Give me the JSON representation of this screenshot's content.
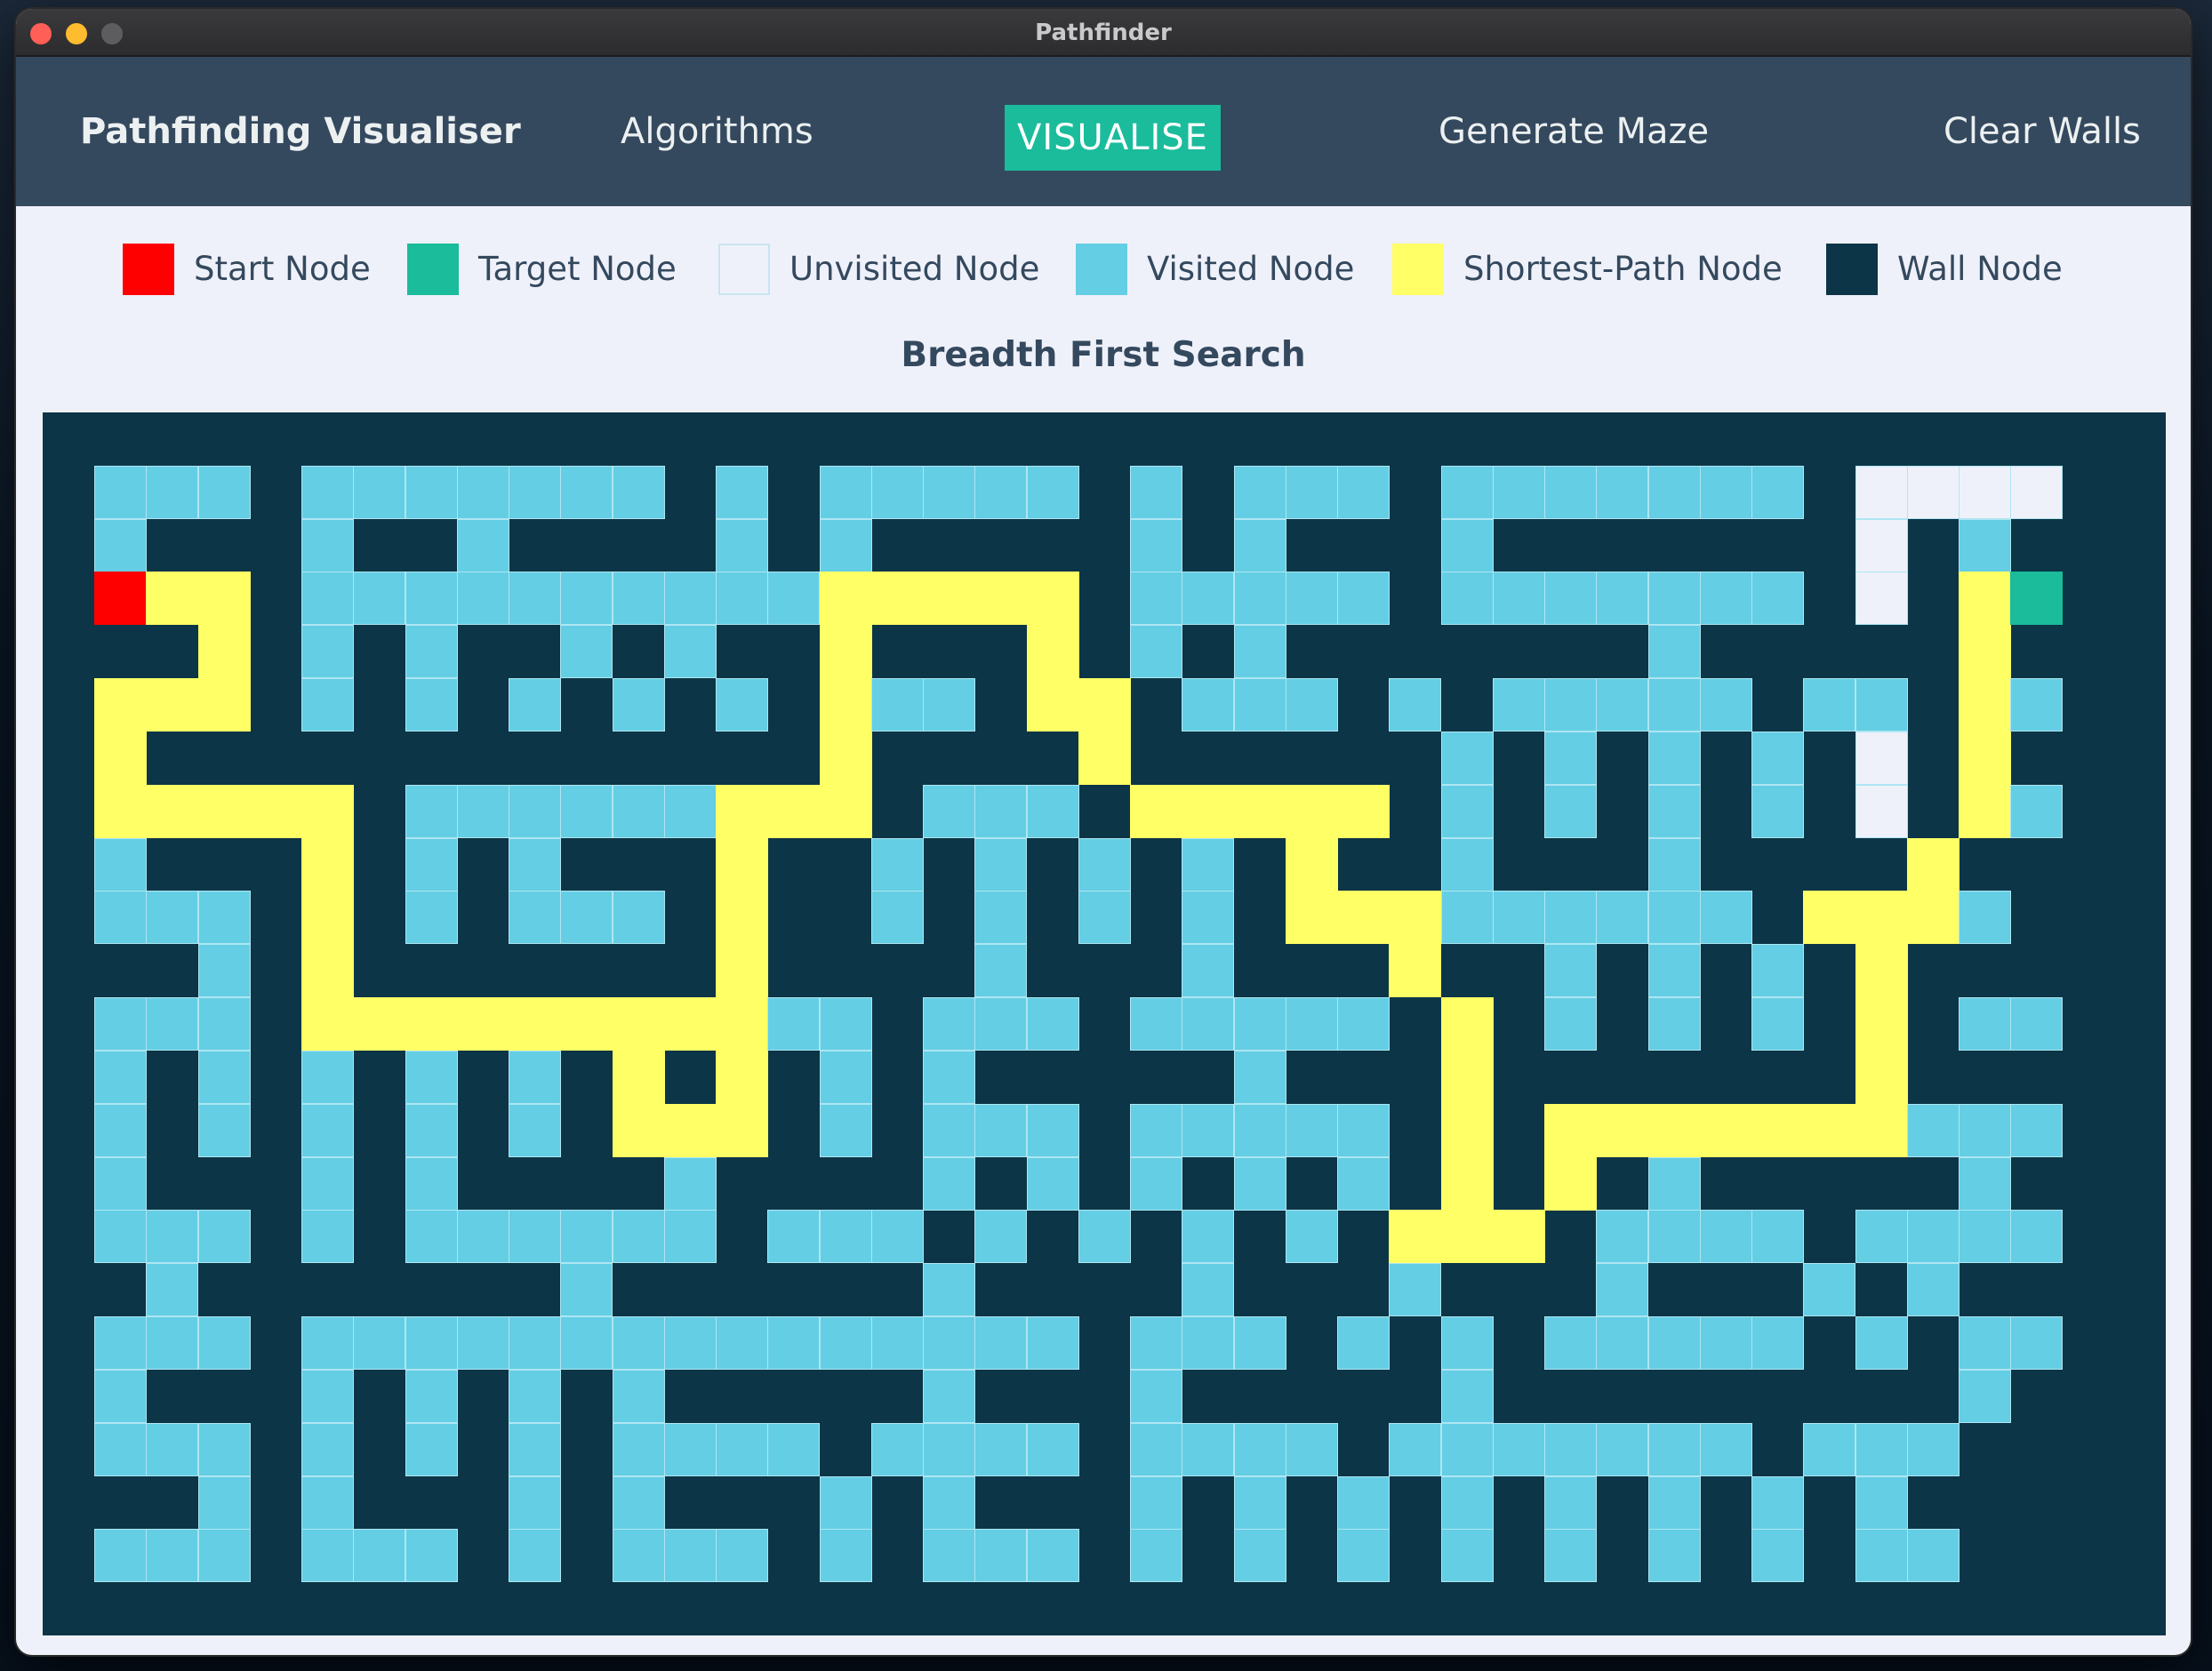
{
  "window": {
    "title": "Pathfinder"
  },
  "navbar": {
    "brand": "Pathfinding Visualiser",
    "algorithms_label": "Algorithms",
    "visualise_label": "VISUALISE",
    "generate_maze_label": "Generate Maze",
    "clear_walls_label": "Clear Walls"
  },
  "legend": {
    "items": [
      {
        "label": "Start Node",
        "color": "#ff0000"
      },
      {
        "label": "Target Node",
        "color": "#1abc9c"
      },
      {
        "label": "Unvisited Node",
        "color": "#eff1fa"
      },
      {
        "label": "Visited Node",
        "color": "#64cee4"
      },
      {
        "label": "Shortest-Path Node",
        "color": "#ffff66"
      },
      {
        "label": "Wall Node",
        "color": "#0c3547"
      }
    ]
  },
  "current_algorithm": "Breadth First Search",
  "grid": {
    "cell_codes": {
      "W": "wall",
      "V": "visited",
      "U": "unvisited",
      "P": "shortest-path",
      "S": "start",
      "T": "target"
    },
    "colors": {
      "wall": "#0c3547",
      "visited": "#64cee4",
      "unvisited": "#eff1fa",
      "path": "#ffff66",
      "start": "#ff0000",
      "target": "#1abc9c",
      "cell_border": "#aee6f2"
    },
    "rows": [
      "WWWWWWWWWWWWWWWWWWWWWWWWWWWWWWWWWWWWWWWWW",
      "WVVVWVVVVVVVWVWVVVVVWVWVVVWVVVVVVVWUUUUW",
      "WVWWWVWWVWWWWVWVWWWWWVWVWWWVWWWWWWWUWVWW",
      "WSPPWVVVVVVVVVVPPPPPWVVVVVWVVVVVVVWUWPTW",
      "WWWPWVWVWWVWVWWPWWWPWVWVWWWWWWWVWWWWWPWW",
      "WPPPWVWVWVWVWVWPVVWPPWVVVWVWVVVVVWVVWPVW",
      "WPWWWWWWWWWWWWWPWWWWPWWWWWWVWVWVWVWUWPWW",
      "WPPPPPWVVVVVVPPPWVVVWPPPPPWVWVWVWVWUWPVW",
      "WVWWWPWVWVWWWPWWVWVWVWVWPWWVWWWVWWWWPWWW",
      "WVVVWPWVWVVVWPWWVWVWVWVWPPPVVVVVVWPPPVW",
      "WWWVWPWWWWWWWPWWWWVWWWVWWWPWWVWVWVWPWWWW",
      "WVVVWPPPPPPPPPVVWVVVWVVVVVWPWVWVWVWPWVVW",
      "WVWVWVWVWVWPWPWVWVWWWWWVWWWPWWWWWWWPWWWW",
      "WVWVWVWVWVWPPPWVWVVVWVVVVVWPWPPPPPPPVVVW",
      "WVWWWVWVWWWWVWWWWVWVWVWVWVWPWPWVWWWWWVWW",
      "WVVVWVWVVVVVVWVVVWVWVWVWVWPPPWVVVVWVVVVW",
      "WWVWWWWWWWVWWWWWWVWWWWVWWWVWWWVWWWVWVWW",
      "WVVVWVVVVVVVVVVVVVVVWVVVWVWVWVVVVVWVWVVW",
      "WVWWWVWVWVWVWWWWWVWWWVWWWWWVWWWWWWWWWVWW",
      "WVVVWVWVWVWVVVVWVVVVWVVVVWVVVVVVVWVVVW",
      "WWWVWVWWWVWVWWWVWVWWWVWVWVWVWVWVWVWVWWW",
      "WVVVWVVVWVWVVVWVWVVVWVWVWVWVWVWVWVWVVW",
      "WWWWWWWWWWWWWWWWWWWWWWWWWWWWWWWWWWWWWWWWW"
    ]
  }
}
